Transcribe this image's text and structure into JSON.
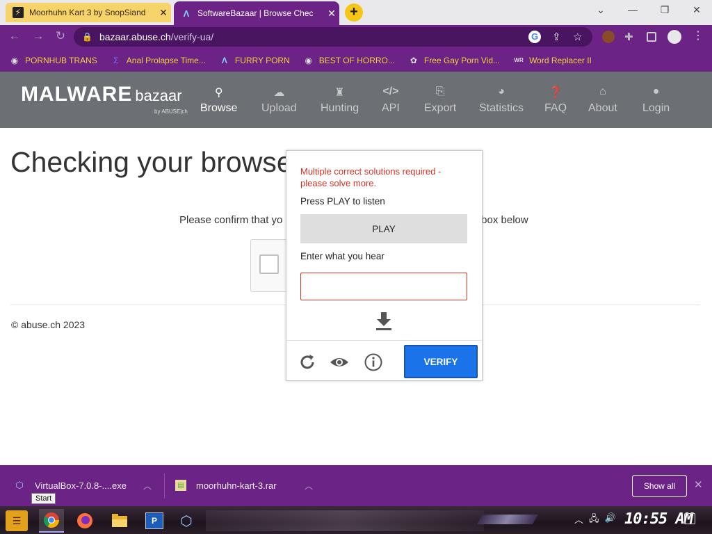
{
  "browser": {
    "tabs": [
      {
        "title": "Moorhuhn Kart 3 by SnopSiand",
        "favicon": "zap-icon"
      },
      {
        "title": "SoftwareBazaar | Browse Chec",
        "favicon": "lambda-icon"
      }
    ],
    "new_tab_label": "+",
    "url_host": "bazaar.abuse.ch",
    "url_path": "/verify-ua/"
  },
  "bookmarks": [
    {
      "label": "PORNHUB TRANS",
      "icon": "globe-icon"
    },
    {
      "label": "Anal Prolapse Time...",
      "icon": "sigma-icon"
    },
    {
      "label": "FURRY PORN",
      "icon": "lambda-icon"
    },
    {
      "label": "BEST OF HORRO...",
      "icon": "globe-icon"
    },
    {
      "label": "Free Gay Porn Vid...",
      "icon": "gear-icon"
    },
    {
      "label": "Word Replacer II",
      "icon": "wr-icon"
    }
  ],
  "site": {
    "logo_main": "MALWARE",
    "logo_sub": "bazaar",
    "logo_by": "by ABUSE|ch",
    "nav": [
      {
        "label": "Browse",
        "icon": "search-icon",
        "active": true
      },
      {
        "label": "Upload",
        "icon": "upload-icon",
        "active": false
      },
      {
        "label": "Hunting",
        "icon": "hunting-icon",
        "active": false
      },
      {
        "label": "API",
        "icon": "code-icon",
        "active": false
      },
      {
        "label": "Export",
        "icon": "export-icon",
        "active": false
      },
      {
        "label": "Statistics",
        "icon": "pie-chart-icon",
        "active": false
      },
      {
        "label": "FAQ",
        "icon": "question-icon",
        "active": false
      },
      {
        "label": "About",
        "icon": "building-icon",
        "active": false
      },
      {
        "label": "Login",
        "icon": "user-icon",
        "active": false
      }
    ]
  },
  "page": {
    "title": "Checking your browser",
    "confirm_left": "Please confirm that yo",
    "confirm_right": "tbox below",
    "footer": "© abuse.ch 2023"
  },
  "challenge": {
    "error": "Multiple correct solutions required - please solve more.",
    "press_play": "Press PLAY to listen",
    "play_label": "PLAY",
    "enter_label": "Enter what you hear",
    "answer_value": "",
    "verify_label": "VERIFY"
  },
  "downloads": {
    "items": [
      {
        "name": "VirtualBox-7.0.8-....exe",
        "icon": "virtualbox-icon"
      },
      {
        "name": "moorhuhn-kart-3.rar",
        "icon": "archive-icon"
      }
    ],
    "show_all": "Show all",
    "tooltip": "Start"
  },
  "taskbar": {
    "clock": "10:55 AM"
  },
  "colors": {
    "browser_purple": "#6b2386",
    "bookmark_text": "#f7d03a",
    "header_gray": "#6c6f73",
    "error_red": "#d93025",
    "verify_blue": "#1a73e8"
  }
}
